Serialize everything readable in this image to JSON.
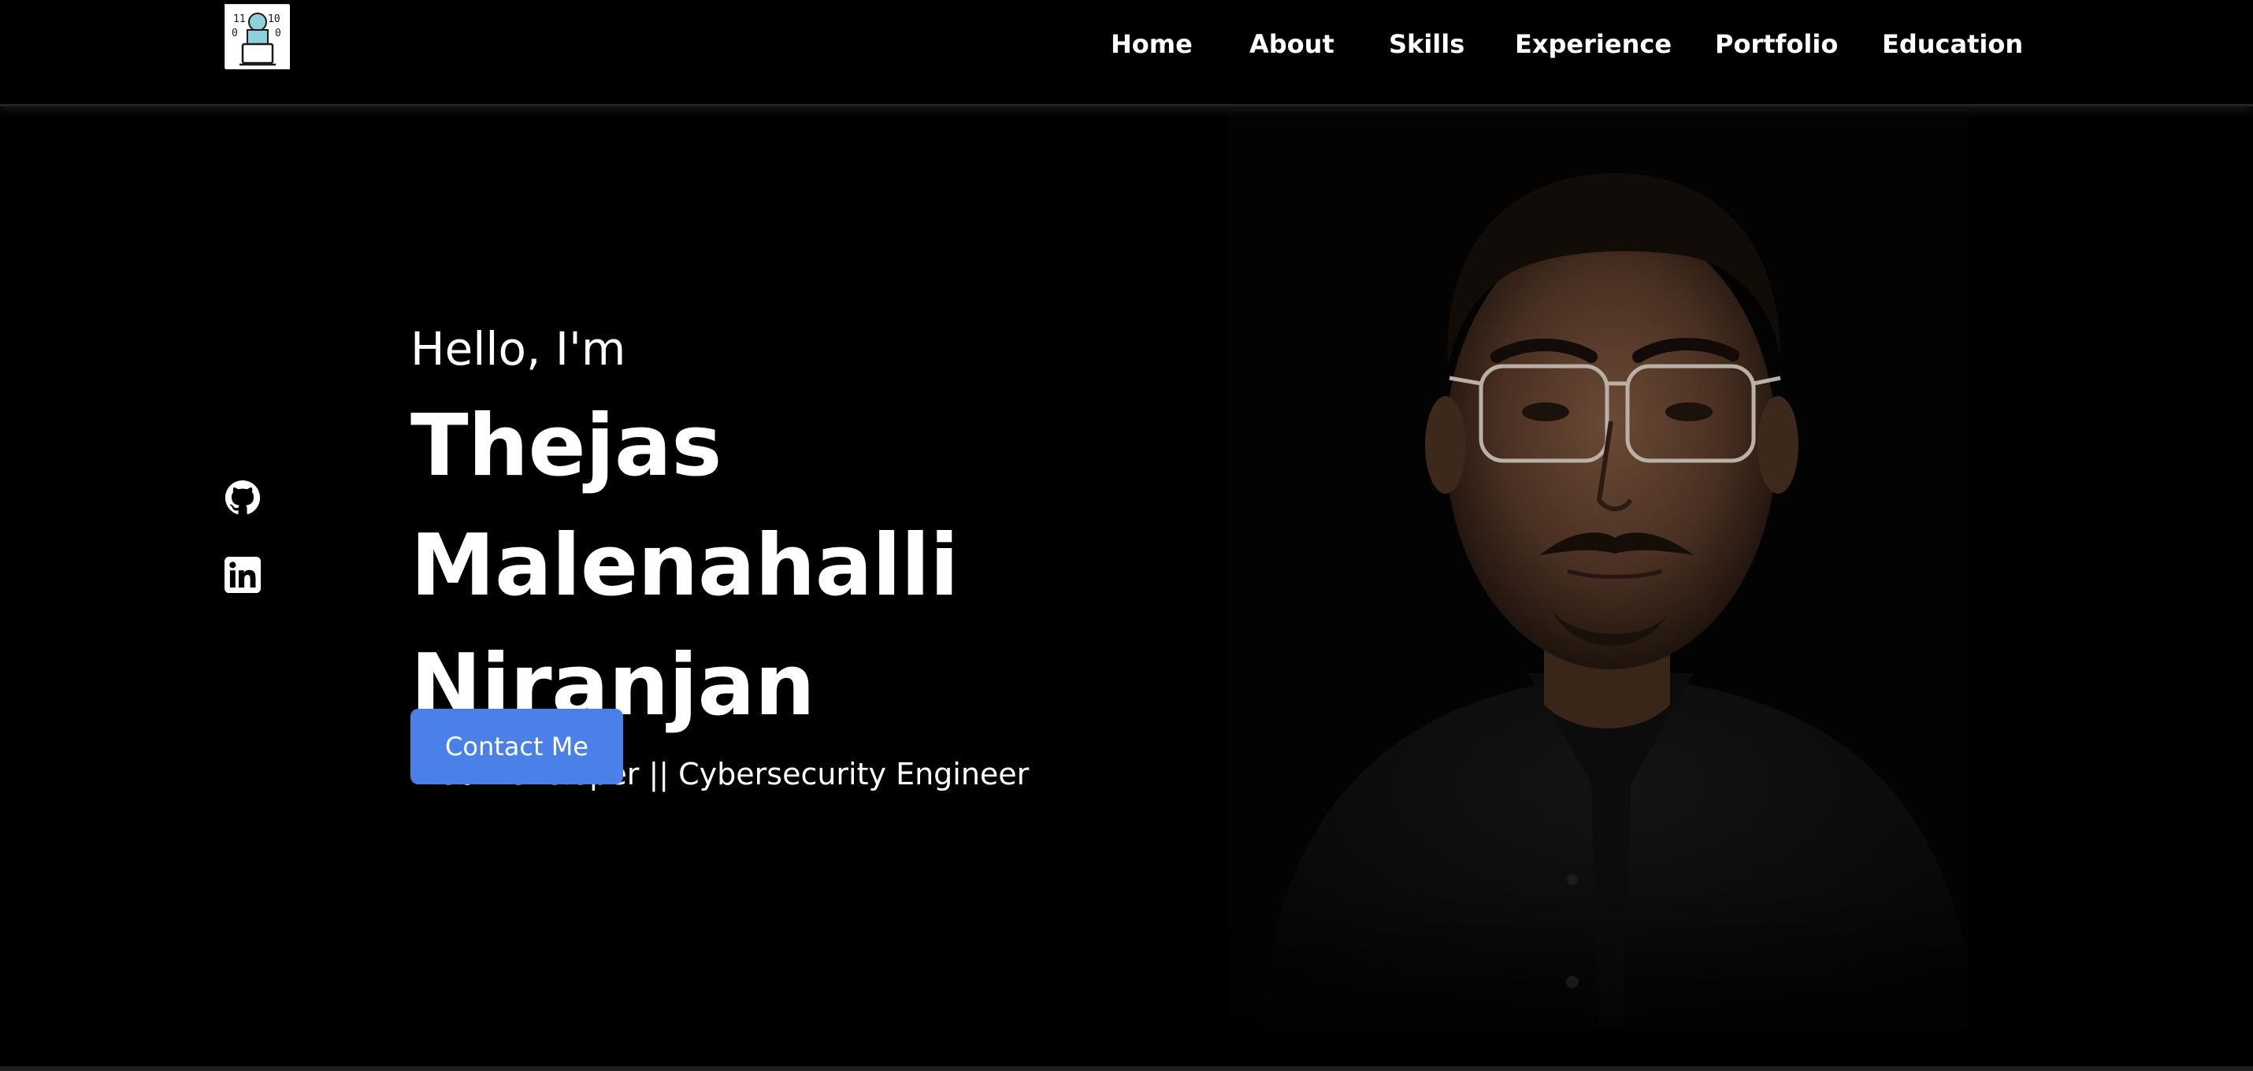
{
  "header": {
    "logo_icon": "logo-coder-icon",
    "nav": [
      {
        "label": "Home"
      },
      {
        "label": "About"
      },
      {
        "label": "Skills"
      },
      {
        "label": "Experience"
      },
      {
        "label": "Portfolio"
      },
      {
        "label": "Education"
      }
    ]
  },
  "social": [
    {
      "icon": "github-icon"
    },
    {
      "icon": "linkedin-icon"
    }
  ],
  "hero": {
    "greeting": "Hello, I'm",
    "name": "Thejas Malenahalli Niranjan",
    "tagline": "Web Developer || Cybersecurity Engineer",
    "cta_label": "Contact Me"
  },
  "portrait": {
    "icon": "profile-photo"
  },
  "colors": {
    "background": "#000000",
    "text": "#ffffff",
    "accent": "#4a80e8"
  }
}
